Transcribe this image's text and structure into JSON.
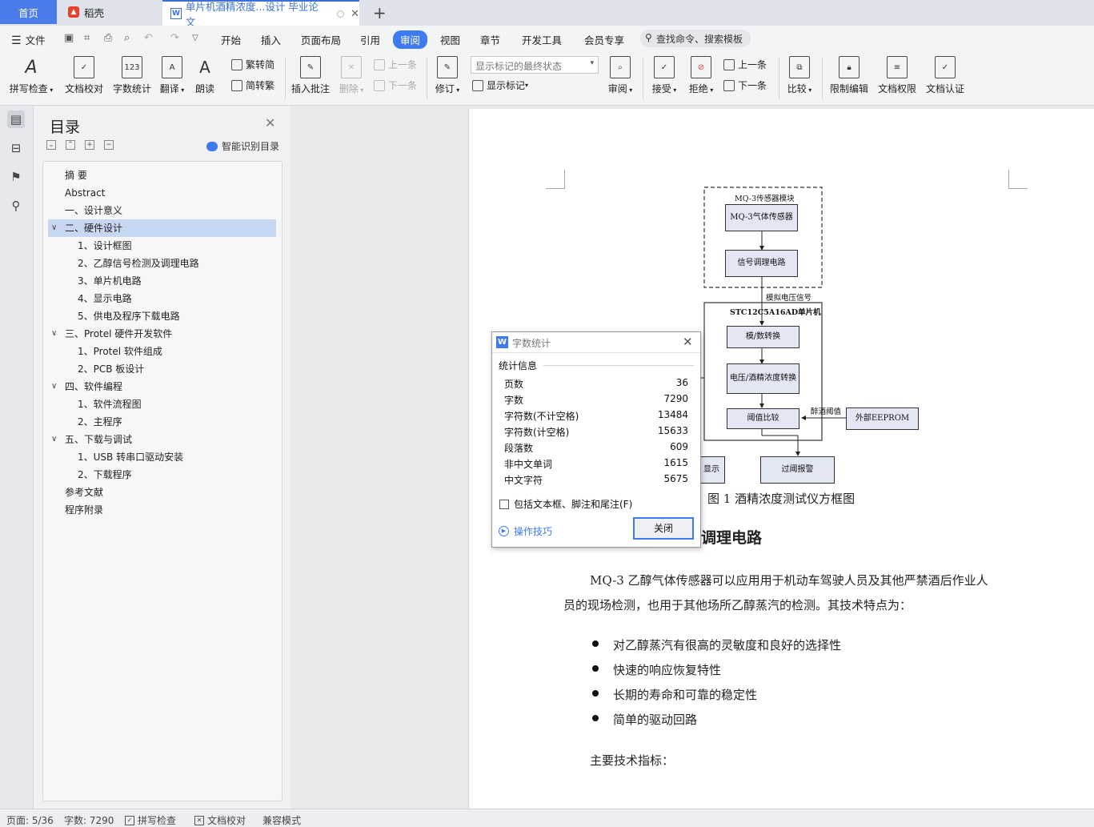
{
  "tabs": {
    "home": "首页",
    "daoke": "稻壳",
    "document": "单片机酒精浓度...设计 毕业论文"
  },
  "menu": {
    "file": "文件",
    "items": [
      "开始",
      "插入",
      "页面布局",
      "引用",
      "审阅",
      "视图",
      "章节",
      "开发工具",
      "会员专享"
    ],
    "search": "查找命令、搜索模板"
  },
  "ribbon": {
    "spellcheck": "拼写检查",
    "doc_proof": "文档校对",
    "word_count": "字数统计",
    "translate": "翻译",
    "read_aloud": "朗读",
    "trad_to_simp": "繁转简",
    "simp_to_trad": "简转繁",
    "insert_comment": "插入批注",
    "delete": "删除",
    "prev": "上一条",
    "next": "下一条",
    "track_changes": "修订",
    "markup_state": "显示标记的最终状态",
    "show_markup": "显示标记",
    "review": "审阅",
    "accept": "接受",
    "reject": "拒绝",
    "prev2": "上一条",
    "next2": "下一条",
    "compare": "比较",
    "restrict_edit": "限制编辑",
    "doc_permission": "文档权限",
    "doc_certify": "文档认证"
  },
  "toc": {
    "title": "目录",
    "smart_detect": "智能识别目录",
    "items": [
      {
        "label": "摘  要",
        "level": 1
      },
      {
        "label": "Abstract",
        "level": 1
      },
      {
        "label": "一、设计意义",
        "level": 1
      },
      {
        "label": "二、硬件设计",
        "level": 1
      },
      {
        "label": "1、设计框图",
        "level": 2
      },
      {
        "label": "2、乙醇信号检测及调理电路",
        "level": 2
      },
      {
        "label": "3、单片机电路",
        "level": 2
      },
      {
        "label": "4、显示电路",
        "level": 2
      },
      {
        "label": "5、供电及程序下载电路",
        "level": 2
      },
      {
        "label": "三、Protel 硬件开发软件",
        "level": 1
      },
      {
        "label": "1、Protel 软件组成",
        "level": 2
      },
      {
        "label": "2、PCB 板设计",
        "level": 2
      },
      {
        "label": "四、软件编程",
        "level": 1
      },
      {
        "label": "1、软件流程图",
        "level": 2
      },
      {
        "label": "2、主程序",
        "level": 2
      },
      {
        "label": "五、下载与调试",
        "level": 1
      },
      {
        "label": "1、USB 转串口驱动安装",
        "level": 2
      },
      {
        "label": "2、下载程序",
        "level": 2
      },
      {
        "label": "参考文献",
        "level": 1
      },
      {
        "label": "程序附录",
        "level": 1
      }
    ]
  },
  "diagram": {
    "sensor_module": "MQ-3传感器模块",
    "sensor": "MQ-3气体传感器",
    "conditioning": "信号调理电路",
    "analog_signal": "模拟电压信号",
    "mcu": "STC12C5A16AD单片机",
    "adc": "模/数转换",
    "conversion": "电压/酒精浓度转换",
    "threshold_compare": "阈值比较",
    "drunk_threshold": "醉酒阈值",
    "eeprom": "外部EEPROM",
    "display_partial": "显示",
    "alarm": "过阈报警"
  },
  "document": {
    "figure_caption": "图 1  酒精浓度测试仪方框图",
    "heading_partial": "调理电路",
    "para1_line1": "MQ-3 乙醇气体传感器可以应用用于机动车驾驶人员及其他严禁酒后作业人",
    "para1_line2": "员的现场检测，也用于其他场所乙醇蒸汽的检测。其技术特点为：",
    "bullets": [
      "对乙醇蒸汽有很高的灵敏度和良好的选择性",
      "快速的响应恢复特性",
      "长期的寿命和可靠的稳定性",
      "简单的驱动回路"
    ],
    "main_specs": "主要技术指标："
  },
  "dialog": {
    "title": "字数统计",
    "section": "统计信息",
    "stats": [
      {
        "label": "页数",
        "value": "36"
      },
      {
        "label": "字数",
        "value": "7290"
      },
      {
        "label": "字符数(不计空格)",
        "value": "13484"
      },
      {
        "label": "字符数(计空格)",
        "value": "15633"
      },
      {
        "label": "段落数",
        "value": "609"
      },
      {
        "label": "非中文单词",
        "value": "1615"
      },
      {
        "label": "中文字符",
        "value": "5675"
      }
    ],
    "include_checkbox": "包括文本框、脚注和尾注(F)",
    "tips": "操作技巧",
    "close_button": "关闭"
  },
  "status": {
    "page": "页面: 5/36",
    "words": "字数: 7290",
    "spellcheck": "拼写检查",
    "doc_proof": "文档校对",
    "compat": "兼容模式"
  },
  "colors": {
    "accent": "#3d7af0",
    "toc_selected": "#c8d7f1",
    "diagram_fill": "#e3e7f4"
  }
}
